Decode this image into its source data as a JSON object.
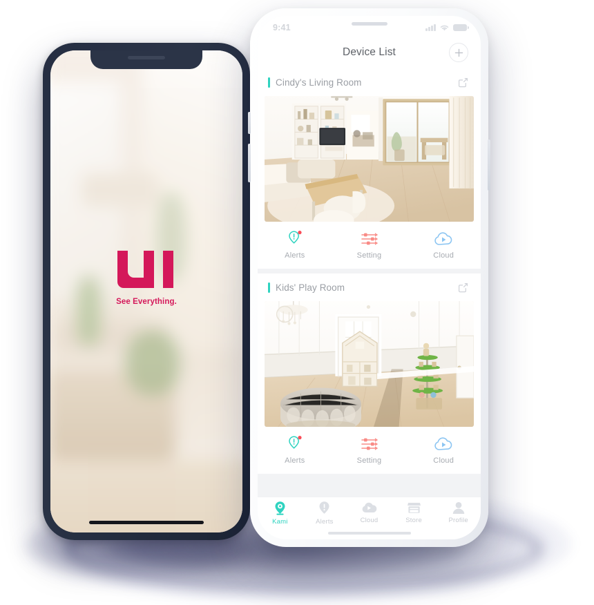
{
  "meta": {
    "scene": "two-phone product mockup of the YI / Kami home security camera app"
  },
  "colors": {
    "accent_teal": "#2fd3c0",
    "accent_red": "#f98b86",
    "accent_blue": "#8cc5f2",
    "brand_crimson": "#d4185a",
    "badge_red": "#fa4b57",
    "dark_frame": "#2b3447",
    "text_gray": "#9a9ea4",
    "screen_bg": "#f2f3f5"
  },
  "splash_phone": {
    "logo_text": "YI",
    "tagline": "See Everything."
  },
  "app_phone": {
    "status_bar": {
      "time": "9:41",
      "icons": [
        "signal-icon",
        "wifi-icon",
        "battery-icon"
      ]
    },
    "navbar": {
      "title": "Device List",
      "add_button_label": "+",
      "add_button_icon": "plus-icon"
    },
    "cards": [
      {
        "title": "Cindy's Living Room",
        "share_icon": "share-icon",
        "thumbnail_alt": "living room with white built-in shelves, television, wooden floor and sliding glass door",
        "actions": [
          {
            "label": "Alerts",
            "icon": "alert-pin-icon",
            "badge": true,
            "color": "#2fd3c0"
          },
          {
            "label": "Setting",
            "icon": "sliders-icon",
            "badge": false,
            "color": "#f98b86"
          },
          {
            "label": "Cloud",
            "icon": "cloud-play-icon",
            "badge": false,
            "color": "#8cc5f2"
          }
        ]
      },
      {
        "title": "Kids' Play Room",
        "share_icon": "share-icon",
        "thumbnail_alt": "bright white playroom with round tufted ottoman, wooden playhouse shelf and toy tree",
        "actions": [
          {
            "label": "Alerts",
            "icon": "alert-pin-icon",
            "badge": true,
            "color": "#2fd3c0"
          },
          {
            "label": "Setting",
            "icon": "sliders-icon",
            "badge": false,
            "color": "#f98b86"
          },
          {
            "label": "Cloud",
            "icon": "cloud-play-icon",
            "badge": false,
            "color": "#8cc5f2"
          }
        ]
      }
    ],
    "tabbar": [
      {
        "label": "Kami",
        "icon": "camera-icon",
        "active": true
      },
      {
        "label": "Alerts",
        "icon": "alert-pin-icon",
        "active": false
      },
      {
        "label": "Cloud",
        "icon": "cloud-play-icon",
        "active": false
      },
      {
        "label": "Store",
        "icon": "store-icon",
        "active": false
      },
      {
        "label": "Profile",
        "icon": "person-icon",
        "active": false
      }
    ]
  }
}
